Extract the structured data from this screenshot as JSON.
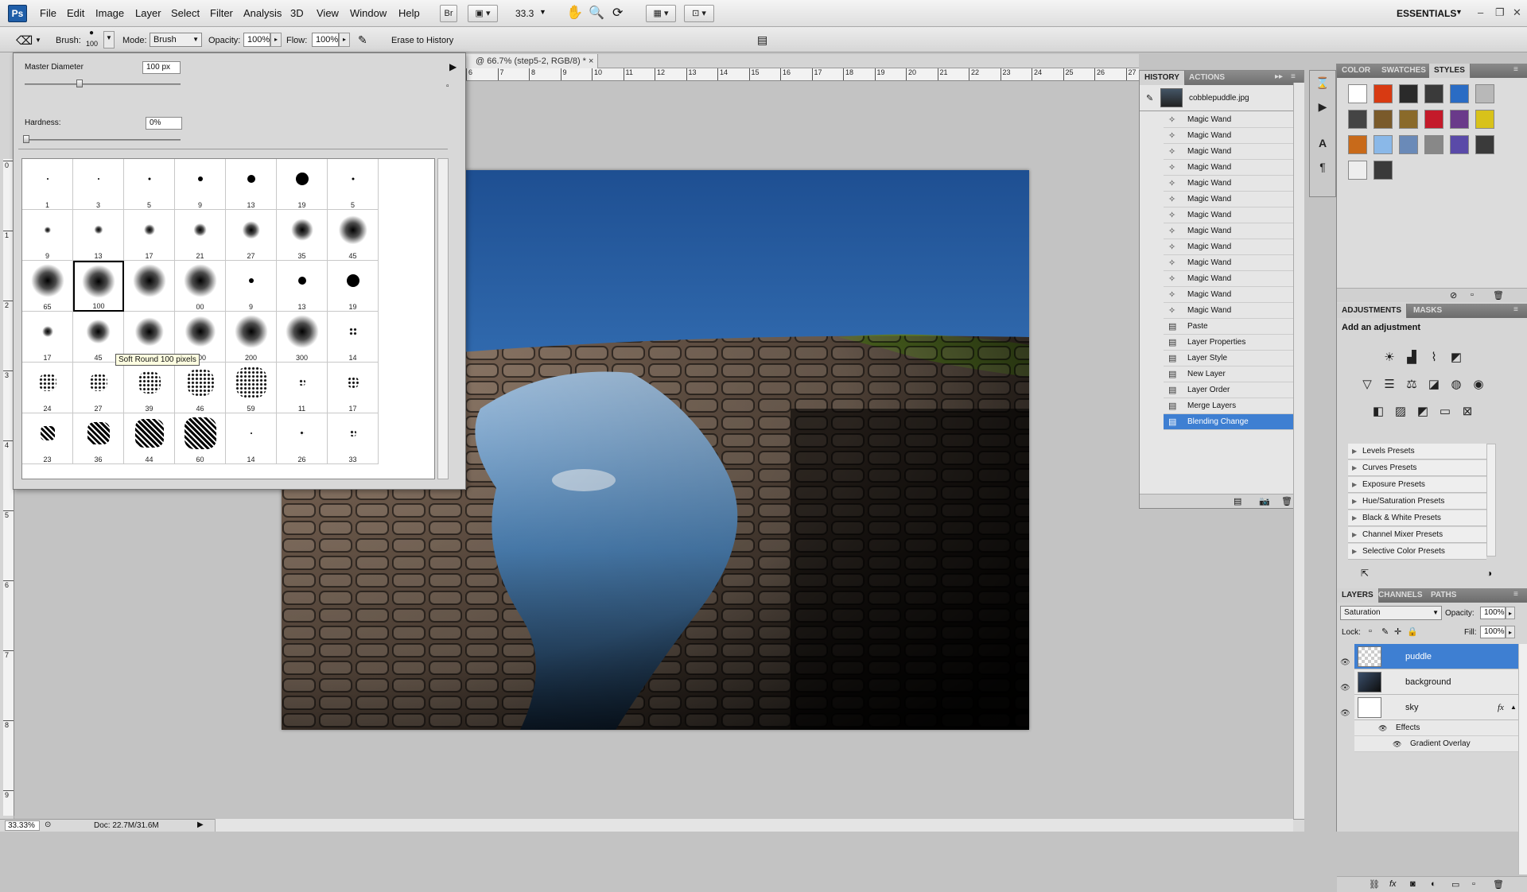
{
  "app": {
    "logo": "Ps"
  },
  "menu": [
    "File",
    "Edit",
    "Image",
    "Layer",
    "Select",
    "Filter",
    "Analysis",
    "3D",
    "View",
    "Window",
    "Help"
  ],
  "toolbar": {
    "bridge": "Br",
    "zoom": "33.3",
    "workspace": "ESSENTIALS"
  },
  "options": {
    "brush_label": "Brush:",
    "brush_size": "100",
    "mode_label": "Mode:",
    "mode_value": "Brush",
    "opacity_label": "Opacity:",
    "opacity_value": "100%",
    "flow_label": "Flow:",
    "flow_value": "100%",
    "erase_label": "Erase to History"
  },
  "document": {
    "tab_title": "@ 66.7% (step5-2, RGB/8) *",
    "tab_close": "×"
  },
  "ruler_top": [
    "6",
    "7",
    "8",
    "9",
    "10",
    "11",
    "12",
    "13",
    "14",
    "15",
    "16",
    "17",
    "18",
    "19",
    "20",
    "21",
    "22",
    "23",
    "24",
    "25",
    "26",
    "27"
  ],
  "ruler_left": [
    "0",
    "1",
    "2",
    "3",
    "4",
    "5",
    "6",
    "7",
    "8",
    "9"
  ],
  "brush_picker": {
    "master_diameter_label": "Master Diameter",
    "master_diameter_value": "100 px",
    "master_diameter_level": 0.35,
    "hardness_label": "Hardness:",
    "hardness_value": "0%",
    "tooltip": "Soft Round 100 pixels",
    "brushes": [
      {
        "label": "1",
        "kind": "hard",
        "d": 2
      },
      {
        "label": "3",
        "kind": "hard",
        "d": 2
      },
      {
        "label": "5",
        "kind": "hard",
        "d": 3
      },
      {
        "label": "9",
        "kind": "hard",
        "d": 6
      },
      {
        "label": "13",
        "kind": "hard",
        "d": 10
      },
      {
        "label": "19",
        "kind": "hard",
        "d": 16
      },
      {
        "label": "5",
        "kind": "hard",
        "d": 3
      },
      {
        "label": "9",
        "kind": "soft",
        "d": 6
      },
      {
        "label": "13",
        "kind": "soft",
        "d": 8
      },
      {
        "label": "17",
        "kind": "soft",
        "d": 10
      },
      {
        "label": "21",
        "kind": "soft",
        "d": 12
      },
      {
        "label": "27",
        "kind": "soft",
        "d": 16
      },
      {
        "label": "35",
        "kind": "soft",
        "d": 20
      },
      {
        "label": "45",
        "kind": "soft",
        "d": 26
      },
      {
        "label": "65",
        "kind": "soft",
        "d": 30
      },
      {
        "label": "100",
        "kind": "soft",
        "d": 30,
        "sel": true
      },
      {
        "label": "",
        "kind": "soft",
        "d": 30
      },
      {
        "label": "00",
        "kind": "soft",
        "d": 30
      },
      {
        "label": "9",
        "kind": "hard",
        "d": 6
      },
      {
        "label": "13",
        "kind": "hard",
        "d": 10
      },
      {
        "label": "19",
        "kind": "hard",
        "d": 16
      },
      {
        "label": "17",
        "kind": "soft",
        "d": 10
      },
      {
        "label": "45",
        "kind": "soft",
        "d": 22
      },
      {
        "label": "65",
        "kind": "soft",
        "d": 26
      },
      {
        "label": "100",
        "kind": "soft",
        "d": 28
      },
      {
        "label": "200",
        "kind": "soft",
        "d": 30
      },
      {
        "label": "300",
        "kind": "soft",
        "d": 30
      },
      {
        "label": "14",
        "kind": "scatter",
        "d": 10
      },
      {
        "label": "24",
        "kind": "scatter",
        "d": 22
      },
      {
        "label": "27",
        "kind": "scatter",
        "d": 22
      },
      {
        "label": "39",
        "kind": "scatter",
        "d": 28
      },
      {
        "label": "46",
        "kind": "scatter",
        "d": 34
      },
      {
        "label": "59",
        "kind": "scatter",
        "d": 40
      },
      {
        "label": "11",
        "kind": "scatter",
        "d": 8
      },
      {
        "label": "17",
        "kind": "scatter",
        "d": 14
      },
      {
        "label": "23",
        "kind": "blob",
        "d": 18
      },
      {
        "label": "36",
        "kind": "blob",
        "d": 28
      },
      {
        "label": "44",
        "kind": "blob",
        "d": 36
      },
      {
        "label": "60",
        "kind": "blob",
        "d": 40
      },
      {
        "label": "14",
        "kind": "hard",
        "d": 2
      },
      {
        "label": "26",
        "kind": "scatter",
        "d": 6
      },
      {
        "label": "33",
        "kind": "scatter",
        "d": 8
      }
    ]
  },
  "history": {
    "tabs": [
      "HISTORY",
      "ACTIONS"
    ],
    "snapshot": "cobblepuddle.jpg",
    "items": [
      "Magic Wand",
      "Magic Wand",
      "Magic Wand",
      "Magic Wand",
      "Magic Wand",
      "Magic Wand",
      "Magic Wand",
      "Magic Wand",
      "Magic Wand",
      "Magic Wand",
      "Magic Wand",
      "Magic Wand",
      "Magic Wand",
      "Paste",
      "Layer Properties",
      "Layer Style",
      "New Layer",
      "Layer Order",
      "Merge Layers",
      "Blending Change"
    ]
  },
  "color_panel": {
    "tabs": [
      "COLOR",
      "SWATCHES",
      "STYLES"
    ]
  },
  "adjustments": {
    "tabs": [
      "ADJUSTMENTS",
      "MASKS"
    ],
    "heading": "Add an adjustment",
    "presets": [
      "Levels Presets",
      "Curves Presets",
      "Exposure Presets",
      "Hue/Saturation Presets",
      "Black & White Presets",
      "Channel Mixer Presets",
      "Selective Color Presets"
    ]
  },
  "layers": {
    "tabs": [
      "LAYERS",
      "CHANNELS",
      "PATHS"
    ],
    "blend_mode": "Saturation",
    "opacity_label": "Opacity:",
    "opacity_value": "100%",
    "lock_label": "Lock:",
    "fill_label": "Fill:",
    "fill_value": "100%",
    "rows": [
      "puddle",
      "background",
      "sky"
    ],
    "effects_label": "Effects",
    "effect_item": "Gradient Overlay",
    "fx": "fx"
  },
  "status": {
    "zoom": "33.33%",
    "doc": "Doc: 22.7M/31.6M"
  }
}
